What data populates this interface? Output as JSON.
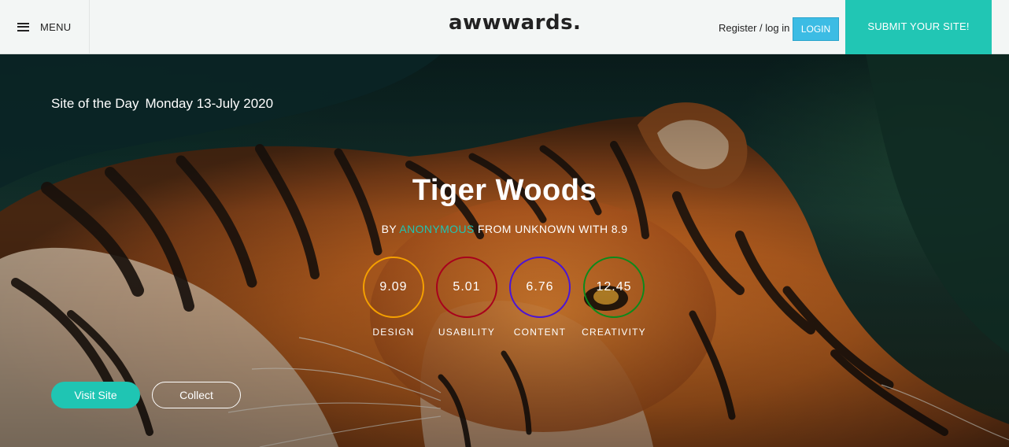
{
  "header": {
    "menu_label": "MENU",
    "logo_text": "awwwards.",
    "register_text": "Register / log in",
    "login_label": "LOGIN",
    "submit_label": "SUBMIT YOUR SITE!"
  },
  "hero": {
    "sotd_label": "Site of the Day",
    "sotd_date": "Monday 13-July 2020",
    "title": "Tiger Woods",
    "byline_prefix": "BY ",
    "byline_author": "ANONYMOUS",
    "byline_suffix": " FROM UNKNOWN WITH 8.9",
    "scores": [
      {
        "value": "9.09",
        "label": "DESIGN",
        "color": "#f5a000"
      },
      {
        "value": "5.01",
        "label": "USABILITY",
        "color": "#a8001c"
      },
      {
        "value": "6.76",
        "label": "CONTENT",
        "color": "#4a14d6"
      },
      {
        "value": "12.45",
        "label": "CREATIVITY",
        "color": "#0c8a1c"
      }
    ],
    "visit_label": "Visit Site",
    "collect_label": "Collect"
  },
  "colors": {
    "accent": "#21c6b4",
    "login_blue": "#3cbce4"
  }
}
